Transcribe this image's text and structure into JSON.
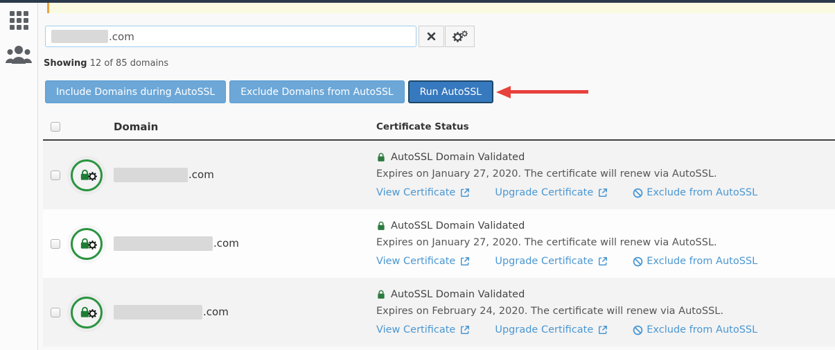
{
  "topbar": {},
  "notice": {
    "bg": "#fafae2",
    "accent": "#e9a33c"
  },
  "sidebar": {
    "icons": [
      {
        "name": "grid-icon"
      },
      {
        "name": "people-icon"
      }
    ]
  },
  "search": {
    "value_visible": ".com",
    "value_redacted": true,
    "clear_button": "clear",
    "settings_button": "settings"
  },
  "summary": {
    "bold": "Showing",
    "rest": "12 of 85 domains"
  },
  "toolbar": {
    "include_label": "Include Domains during AutoSSL",
    "exclude_label": "Exclude Domains from AutoSSL",
    "run_label": "Run AutoSSL"
  },
  "annotation": {
    "type": "red-arrow",
    "points_at": "run-autossl-button"
  },
  "table": {
    "domain_header": "Domain",
    "status_header": "Certificate Status",
    "rows": [
      {
        "domain_redacted": true,
        "domain_visible": ".com",
        "status_title": "AutoSSL Domain Validated",
        "expires": "Expires on January 27, 2020. The certificate will renew via AutoSSL.",
        "view_link": "View Certificate",
        "upgrade_link": "Upgrade Certificate",
        "exclude_link": "Exclude from AutoSSL"
      },
      {
        "domain_redacted": true,
        "domain_visible": ".com",
        "status_title": "AutoSSL Domain Validated",
        "expires": "Expires on January 27, 2020. The certificate will renew via AutoSSL.",
        "view_link": "View Certificate",
        "upgrade_link": "Upgrade Certificate",
        "exclude_link": "Exclude from AutoSSL"
      },
      {
        "domain_redacted": true,
        "domain_visible": ".com",
        "status_title": "AutoSSL Domain Validated",
        "expires": "Expires on February 24, 2020. The certificate will renew via AutoSSL.",
        "view_link": "View Certificate",
        "upgrade_link": "Upgrade Certificate",
        "exclude_link": "Exclude from AutoSSL"
      }
    ]
  },
  "colors": {
    "link": "#4a97d2",
    "green_badge": "#2a9440",
    "green_lock": "#2c7b3f",
    "button_light": "#6ca7d8",
    "button_primary": "#3779be",
    "arrow_red": "#e8423d",
    "topbar_navy": "#2b3a4a"
  }
}
